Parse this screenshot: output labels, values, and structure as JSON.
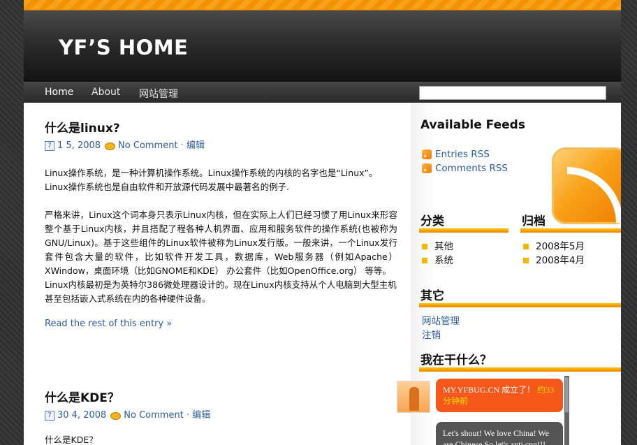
{
  "header": {
    "site_title": "YF’S HOME"
  },
  "nav": {
    "items": [
      {
        "label": "Home",
        "active": true
      },
      {
        "label": "About",
        "active": false
      },
      {
        "label": "网站管理",
        "active": false
      }
    ],
    "search_value": ""
  },
  "posts": [
    {
      "title": "什么是linux?",
      "date": "1 5, 2008",
      "comments": "No Comment",
      "sep": " · ",
      "edit": "编辑",
      "paragraphs": [
        "Linux操作系统，是一种计算机操作系统。Linux操作系统的内核的名字也是“Linux”。Linux操作系统也是自由软件和开放源代码发展中最著名的例子.",
        "严格来讲，Linux这个词本身只表示Linux内核，但在实际上人们已经习惯了用Linux来形容整个基于Linux内核，并且搭配了程各种人机界面、应用和服务软件的操作系统(也被称为GNU/Linux)。基于这些组件的Linux软件被称为Linux发行版。一般来讲，一个Linux发行套件包含大量的软件，比如软件开发工具，数据库，Web服务器（例如Apache） XWindow，桌面环境（比如GNOME和KDE） 办公套件（比如OpenOffice.org） 等等。",
        "Linux内核最初是为英特尔386微处理器设计的。现在Linux内核支持从个人电脑到大型主机甚至包括嵌入式系统在内的各种硬件设备。"
      ],
      "read_more": "Read the rest of this entry »"
    },
    {
      "title": "什么是KDE？",
      "date": "30 4, 2008",
      "comments": "No Comment",
      "sep": " · ",
      "edit": "编辑",
      "paragraphs": [
        "什么是KDE？"
      ]
    }
  ],
  "sidebar": {
    "feeds_title": "Available Feeds",
    "feeds": [
      "Entries RSS",
      "Comments RSS"
    ],
    "categories_title": "分类",
    "categories": [
      "其他",
      "系统"
    ],
    "archives_title": "归档",
    "archives": [
      "2008年5月",
      "2008年4月"
    ],
    "other_title": "其它",
    "other_links": [
      "网站管理",
      "注销"
    ],
    "shout_title": "我在干什么？",
    "shouts": [
      {
        "text": "MY.YFBUG.CN 成立了！",
        "time": "约33分钟前"
      },
      {
        "text": "Let's shout! We love China! We are Chinese.So let's anti cnn!!!",
        "time": ""
      }
    ]
  },
  "colors": {
    "accent": "#f39200",
    "link": "#2d5d9a",
    "shout_orange": "#f6571a"
  }
}
